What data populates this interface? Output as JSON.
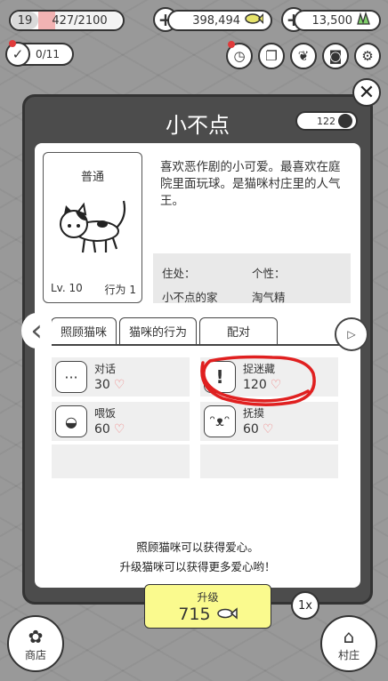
{
  "topbar": {
    "level": "19",
    "xp_text": "427/2100",
    "xp_fraction": 0.2,
    "fish": "398,494",
    "leaf": "13,500",
    "tasks": "0/11"
  },
  "modal": {
    "title": "小不点",
    "yarn": "122",
    "card": {
      "rarity": "普通",
      "level": "Lv. 10",
      "behaviors": "行为 1"
    },
    "description": "喜欢恶作剧的小可爱。最喜欢在庭院里面玩球。是猫咪村庄里的人气王。",
    "home_label": "住处：",
    "home_value": "小不点的家",
    "personality_label": "个性：",
    "personality_value": "淘气精",
    "tabs": [
      "照顾猫咪",
      "猫咪的行为",
      "配对"
    ],
    "care": [
      {
        "name": "对话",
        "value": "30",
        "icon": "dots-icon"
      },
      {
        "name": "捉迷藏",
        "value": "120",
        "icon": "exclamation-icon"
      },
      {
        "name": "喂饭",
        "value": "60",
        "icon": "bowl-icon"
      },
      {
        "name": "抚摸",
        "value": "60",
        "icon": "cat-face-icon"
      }
    ],
    "hint_line1": "照顾猫咪可以获得爱心。",
    "hint_line2": "升级猫咪可以获得更多爱心哟！",
    "upgrade_label": "升级",
    "upgrade_cost": "715",
    "multiplier": "1x"
  },
  "bottom": {
    "shop": "商店",
    "village": "村庄"
  },
  "colors": {
    "xp_fill": "#f2b3b3",
    "upgrade_bg": "#fafa8e",
    "heart": "#f08080",
    "annotation": "#e02020"
  }
}
